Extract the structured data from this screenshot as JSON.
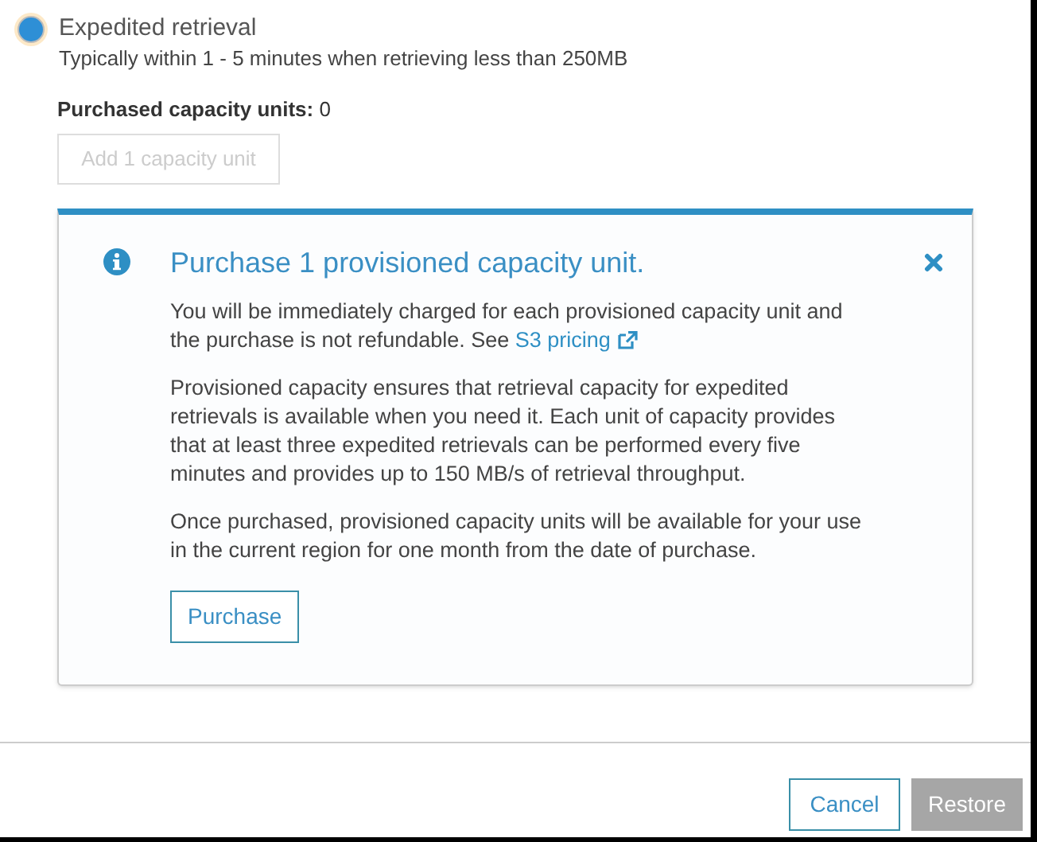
{
  "retrieval_option": {
    "label": "Expedited retrieval",
    "description": "Typically within 1 - 5 minutes when retrieving less than 250MB",
    "selected": true
  },
  "capacity": {
    "label": "Purchased capacity units:",
    "value": "0"
  },
  "add_button": {
    "label": "Add 1 capacity unit",
    "disabled": true
  },
  "alert": {
    "title": "Purchase 1 provisioned capacity unit.",
    "paragraphs": [
      {
        "text": "You will be immediately charged for each provisioned capacity unit and the purchase is not refundable. See ",
        "link": "S3 pricing"
      },
      {
        "text": "Provisioned capacity ensures that retrieval capacity for expedited retrievals is available when you need it. Each unit of capacity provides that at least three expedited retrievals can be performed every five minutes and provides up to 150 MB/s of retrieval throughput."
      },
      {
        "text": "Once purchased, provisioned capacity units will be available for your use in the current region for one month from the date of purchase."
      }
    ],
    "button": "Purchase"
  },
  "footer_buttons": [
    {
      "label": "Cancel",
      "disabled": false
    },
    {
      "label": "Restore",
      "disabled": true
    }
  ]
}
